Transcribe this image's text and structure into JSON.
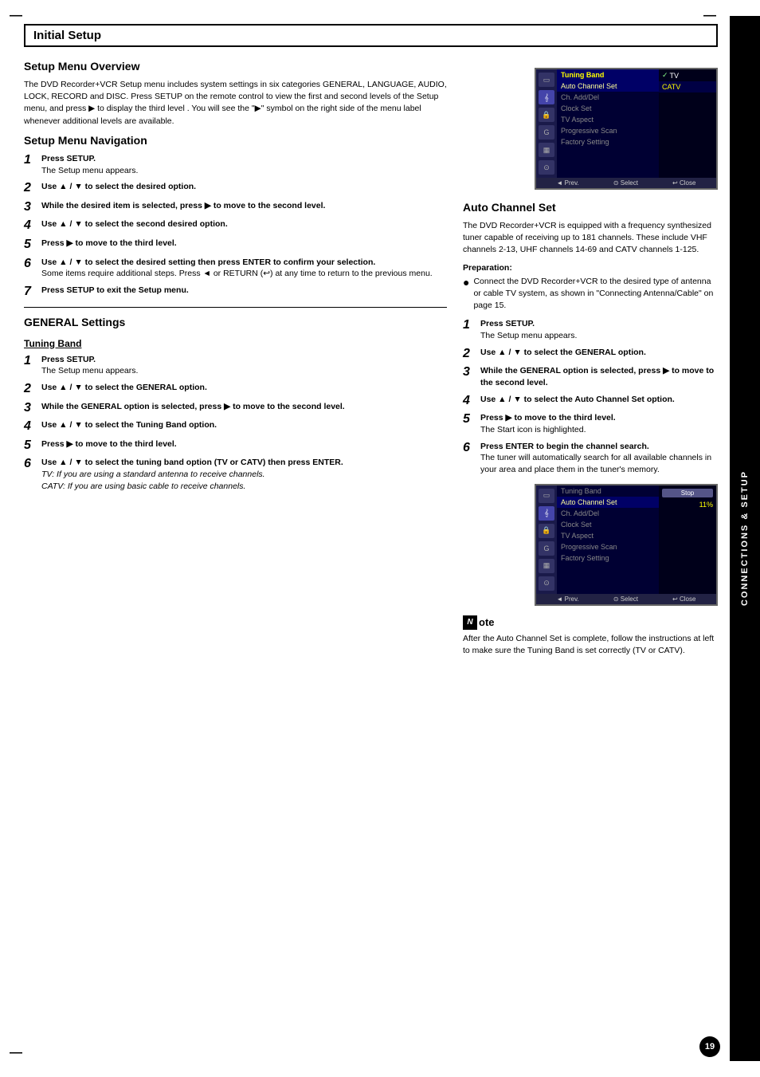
{
  "page": {
    "title": "Initial Setup",
    "number": "19",
    "sidebar_label": "CONNECTIONS & SETUP"
  },
  "setup_menu_overview": {
    "heading": "Setup Menu Overview",
    "body": "The DVD Recorder+VCR Setup menu includes system settings in six categories GENERAL, LANGUAGE, AUDIO, LOCK, RECORD and DISC. Press SETUP on the remote control to view the first and second levels of the Setup menu, and press ▶ to display the third level . You will see the \"▶\" symbol on the right side of the menu label whenever additional levels are available."
  },
  "setup_menu_navigation": {
    "heading": "Setup Menu Navigation",
    "steps": [
      {
        "num": "1",
        "main": "Press SETUP.",
        "sub": "The Setup menu appears."
      },
      {
        "num": "2",
        "main": "Use ▲ / ▼ to select the desired option.",
        "sub": ""
      },
      {
        "num": "3",
        "main": "While the desired item is selected, press ▶ to move to the second level.",
        "sub": ""
      },
      {
        "num": "4",
        "main": "Use ▲ / ▼ to select the second desired option.",
        "sub": ""
      },
      {
        "num": "5",
        "main": "Press ▶ to move to the third level.",
        "sub": ""
      },
      {
        "num": "6",
        "main": "Use ▲ / ▼ to select the desired setting then press ENTER to confirm your selection.",
        "sub": "Some items require additional steps. Press ◄ or RETURN (⏎) at any time to return to the previous menu."
      },
      {
        "num": "7",
        "main": "Press SETUP to exit the Setup menu.",
        "sub": ""
      }
    ]
  },
  "general_settings": {
    "heading": "GENERAL Settings"
  },
  "tuning_band": {
    "heading": "Tuning Band",
    "steps": [
      {
        "num": "1",
        "main": "Press SETUP.",
        "sub": "The Setup menu appears."
      },
      {
        "num": "2",
        "main": "Use ▲ / ▼ to select the GENERAL option.",
        "sub": ""
      },
      {
        "num": "3",
        "main": "While the GENERAL option is selected, press ▶ to move to the second level.",
        "sub": ""
      },
      {
        "num": "4",
        "main": "Use ▲ / ▼ to select the Tuning Band option.",
        "sub": ""
      },
      {
        "num": "5",
        "main": "Press ▶ to move to the third level.",
        "sub": ""
      },
      {
        "num": "6",
        "main": "Use ▲ / ▼ to select the tuning band option (TV or CATV) then press ENTER.",
        "sub_italic": [
          "TV: If you are using a standard antenna to receive channels.",
          "CATV: If you are using basic cable to receive channels."
        ]
      }
    ]
  },
  "auto_channel_set": {
    "heading": "Auto Channel Set",
    "body": "The DVD Recorder+VCR is equipped with a frequency synthesized tuner capable of receiving up to 181 channels. These include VHF channels 2-13, UHF channels 14-69 and CATV channels 1-125.",
    "preparation_label": "Preparation:",
    "bullet": "Connect the DVD Recorder+VCR to the desired type of antenna or cable TV system, as shown in \"Connecting Antenna/Cable\" on page 15.",
    "steps": [
      {
        "num": "1",
        "main": "Press SETUP.",
        "sub": "The Setup menu appears."
      },
      {
        "num": "2",
        "main": "Use ▲ / ▼ to select the GENERAL option.",
        "sub": ""
      },
      {
        "num": "3",
        "main": "While the GENERAL option is selected, press ▶ to move to the second level.",
        "sub": ""
      },
      {
        "num": "4",
        "main": "Use ▲ / ▼ to select the Auto Channel Set option.",
        "sub": ""
      },
      {
        "num": "5",
        "main": "Press ▶ to move to the third level.",
        "sub": "The Start icon is highlighted."
      },
      {
        "num": "6",
        "main": "Press ENTER to begin the channel search.",
        "sub": "The tuner will automatically search for all available channels in your area and place them in the tuner's memory."
      }
    ],
    "note_label": "ote",
    "note_body": "After the Auto Channel Set is complete, follow the instructions at left to make sure the Tuning Band is set correctly (TV or CATV)."
  },
  "menu1": {
    "title": "Tuning Band",
    "items": [
      "Auto Channel Set",
      "Ch. Add/Del",
      "Clock Set",
      "TV Aspect",
      "Progressive Scan",
      "Factory Setting"
    ],
    "right_items": [
      "✓ TV",
      "CATV"
    ],
    "bottom": [
      "◄ Prev.",
      "⊙ Select",
      "↩ Close"
    ]
  },
  "menu2": {
    "title": "Tuning Band",
    "highlighted": "Auto Channel Set",
    "items": [
      "Ch. Add/Del",
      "Clock Set",
      "TV Aspect",
      "Progressive Scan",
      "Factory Setting"
    ],
    "right_stop": "Stop",
    "right_pct": "11%",
    "bottom": [
      "◄ Prev.",
      "⊙ Select",
      "↩ Close"
    ]
  }
}
